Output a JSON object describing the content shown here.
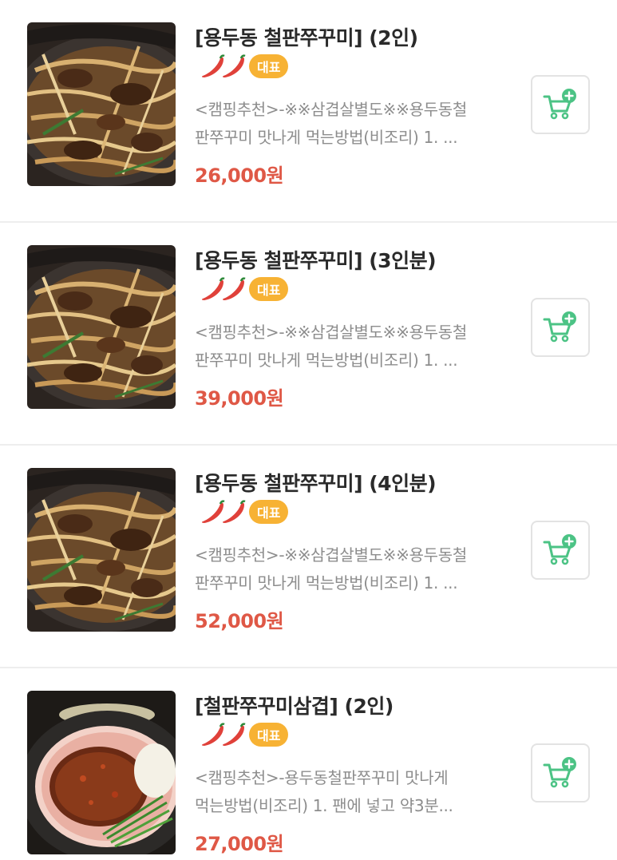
{
  "colors": {
    "price": "#df5846",
    "tag_bg": "#f7b234",
    "cart_green": "#4cc385",
    "chili": "#e0413a",
    "desc": "#8d8d8d"
  },
  "icons": {
    "spicy": "chili-pepper-icon",
    "cart": "add-to-cart-icon"
  },
  "items": [
    {
      "name": "[용두동 철판쭈꾸미] (2인)",
      "tag": "대표",
      "spicy_level": 2,
      "desc_line1": "<캠핑추천>-※※삼겹살별도※※용두동철",
      "desc_line2": "판쭈꾸미 맛나게 먹는방법(비조리) 1. ...",
      "price": "26,000원"
    },
    {
      "name": "[용두동 철판쭈꾸미] (3인분)",
      "tag": "대표",
      "spicy_level": 2,
      "desc_line1": "<캠핑추천>-※※삼겹살별도※※용두동철",
      "desc_line2": "판쭈꾸미 맛나게 먹는방법(비조리) 1. ...",
      "price": "39,000원"
    },
    {
      "name": "[용두동 철판쭈꾸미] (4인분)",
      "tag": "대표",
      "spicy_level": 2,
      "desc_line1": "<캠핑추천>-※※삼겹살별도※※용두동철",
      "desc_line2": "판쭈꾸미 맛나게 먹는방법(비조리) 1. ...",
      "price": "52,000원"
    },
    {
      "name": "[철판쭈꾸미삼겹] (2인)",
      "tag": "대표",
      "spicy_level": 2,
      "desc_line1": "<캠핑추천>-용두동철판쭈꾸미 맛나게",
      "desc_line2": "먹는방법(비조리) 1. 팬에 넣고 약3분...",
      "price": "27,000원"
    }
  ]
}
